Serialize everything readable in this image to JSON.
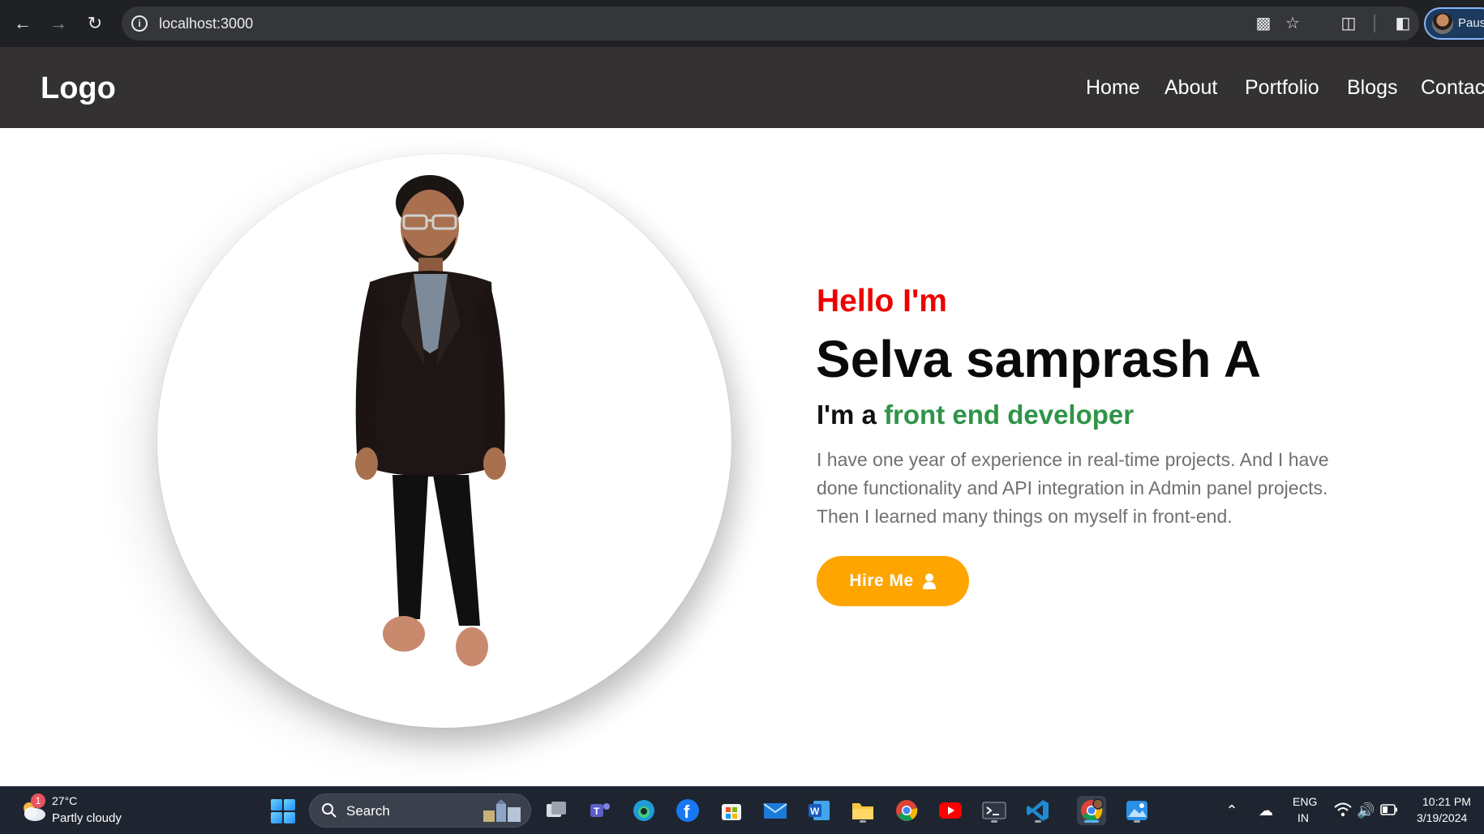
{
  "browser": {
    "url": "localhost:3000",
    "profile_name": "Paus"
  },
  "site": {
    "logo": "Logo",
    "nav": [
      {
        "label": "Home"
      },
      {
        "label": "About"
      },
      {
        "label": "Portfolio"
      },
      {
        "label": "Blogs"
      },
      {
        "label": "Contac"
      }
    ]
  },
  "hero": {
    "greeting": "Hello I'm",
    "name": "Selva samprash A",
    "role_prefix": "I'm a ",
    "role": "front end developer",
    "intro": "I have one year of experience in real-time projects. And I have done functionality and API integration in Admin panel projects. Then I learned many things on myself in front-end.",
    "cta_label": "Hire Me",
    "colors": {
      "greeting": "#ee0000",
      "role": "#2e9448",
      "cta": "#ffa500",
      "header_bg": "#333132"
    }
  },
  "taskbar": {
    "weather_badge": "1",
    "temperature": "27°C",
    "condition": "Partly cloudy",
    "search_label": "Search",
    "apps": [
      "task-view",
      "teams",
      "edge",
      "facebook",
      "store",
      "mail",
      "word",
      "file-explorer",
      "chrome",
      "youtube",
      "terminal",
      "vscode",
      "chrome-profile",
      "photos"
    ],
    "language": "ENG",
    "region": "IN",
    "time": "10:21 PM",
    "date": "3/19/2024"
  }
}
